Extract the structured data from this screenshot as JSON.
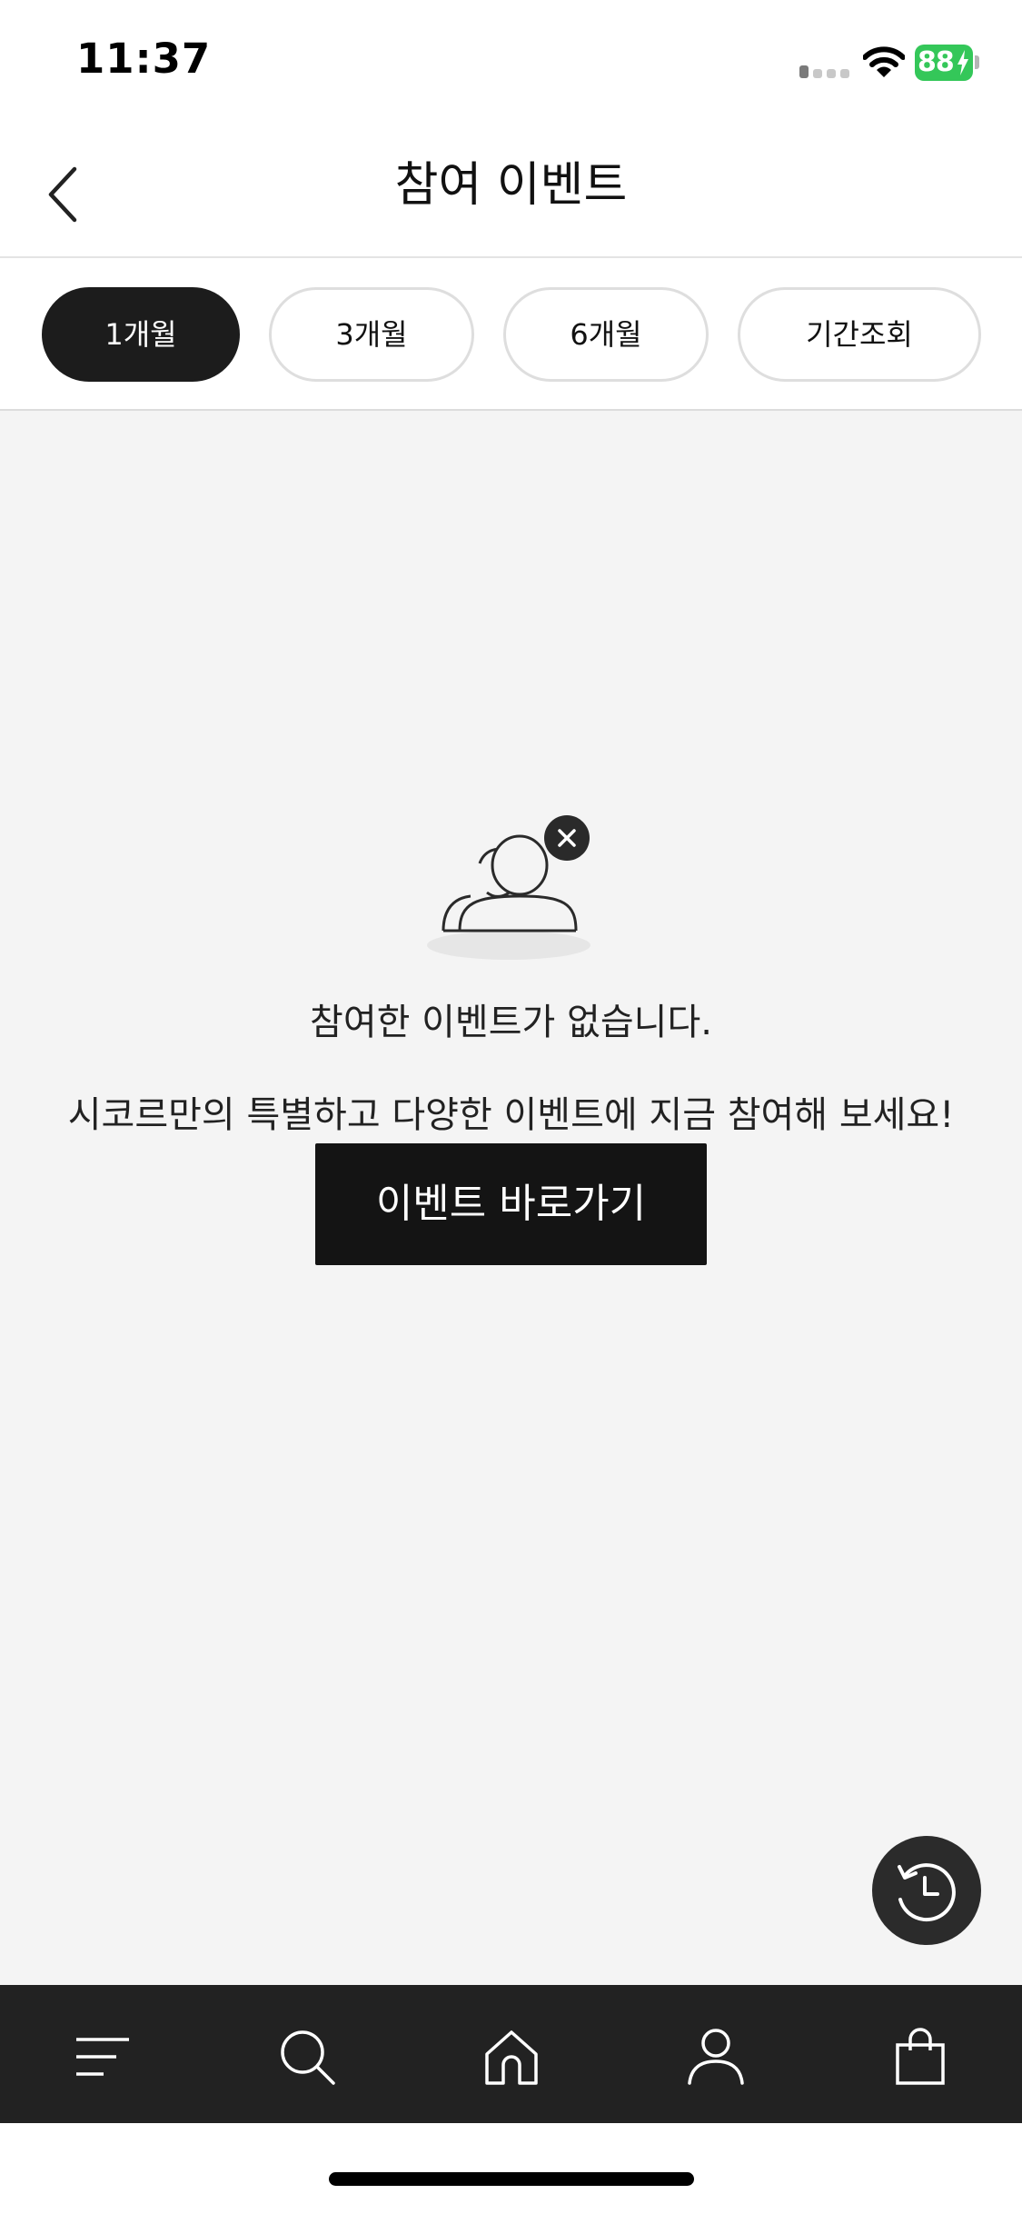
{
  "status_bar": {
    "time": "11:37",
    "battery": "88"
  },
  "header": {
    "title": "참여 이벤트"
  },
  "filters": {
    "items": [
      {
        "label": "1개월",
        "active": true
      },
      {
        "label": "3개월",
        "active": false
      },
      {
        "label": "6개월",
        "active": false
      },
      {
        "label": "기간조회",
        "active": false
      }
    ]
  },
  "empty_state": {
    "title": "참여한 이벤트가 없습니다.",
    "description": "시코르만의 특별하고 다양한 이벤트에 지금 참여해 보세요!",
    "button_label": "이벤트 바로가기"
  },
  "icons": {
    "back": "chevron-left-icon",
    "empty": "users-x-icon",
    "history": "history-icon",
    "nav": [
      "menu-icon",
      "search-icon",
      "home-icon",
      "user-icon",
      "shopping-bag-icon"
    ]
  },
  "colors": {
    "accent_dark": "#1c1c1c",
    "content_bg": "#f4f4f4",
    "battery_green": "#34c759"
  }
}
